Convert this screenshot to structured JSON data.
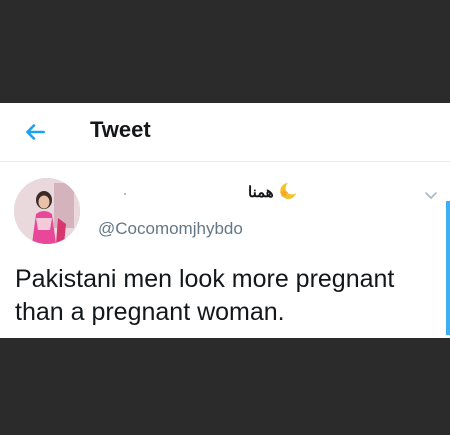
{
  "header": {
    "title": "Tweet"
  },
  "tweet": {
    "display_name": "همنا",
    "handle": "@Cocomomjhybdo",
    "text": "Pakistani men look more pregnant than a pregnant woman."
  },
  "icons": {
    "back": "arrow-left-icon",
    "caret": "chevron-down-icon",
    "name_emoji": "crescent-moon-star-icon"
  },
  "colors": {
    "accent": "#1da1f2",
    "text": "#14171a",
    "muted": "#657786"
  }
}
